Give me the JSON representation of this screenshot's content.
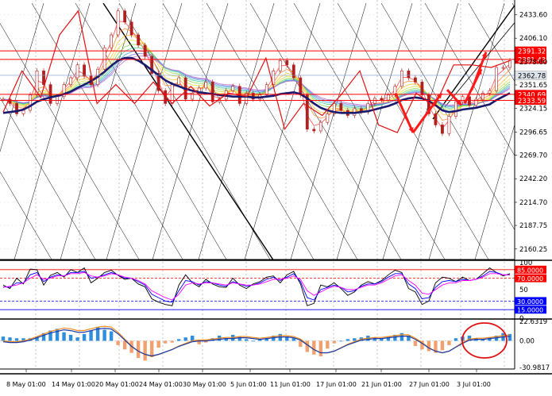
{
  "chart_data": {
    "type": "line",
    "instrument_note": "",
    "x_tick_labels": [
      "8 May 01:00",
      "14 May 01:00",
      "20 May 01:00",
      "24 May 01:00",
      "30 May 01:00",
      "5 Jun 01:00",
      "11 Jun 01:00",
      "17 Jun 01:00",
      "21 Jun 01:00",
      "27 Jun 01:00",
      "3 Jul 01:00"
    ],
    "main": {
      "ylim": [
        2148.0,
        2447.0
      ],
      "y_ticks": [
        "2433.60",
        "2406.10",
        "2378.60",
        "2351.65",
        "2324.15",
        "2296.65",
        "2269.70",
        "2242.20",
        "2214.70",
        "2187.75",
        "2160.25"
      ],
      "price_tag": {
        "text": "2362.78",
        "value": 2362.78
      },
      "levels": [
        {
          "label": "2391.32",
          "value": 2391.32,
          "color": "#ff0000"
        },
        {
          "label": "2381.43",
          "value": 2381.43,
          "color": "#ff0000"
        },
        {
          "label": "2340.69",
          "value": 2340.69,
          "color": "#ff0000"
        },
        {
          "label": "2333.59",
          "value": 2333.59,
          "color": "#ff0000"
        }
      ],
      "price": [
        2335,
        2330,
        2318,
        2322,
        2340,
        2368,
        2352,
        2330,
        2338,
        2352,
        2360,
        2375,
        2362,
        2352,
        2370,
        2395,
        2410,
        2438,
        2425,
        2410,
        2398,
        2385,
        2365,
        2345,
        2330,
        2352,
        2360,
        2335,
        2342,
        2348,
        2355,
        2332,
        2335,
        2345,
        2350,
        2330,
        2342,
        2335,
        2340,
        2352,
        2368,
        2380,
        2375,
        2360,
        2340,
        2300,
        2298,
        2308,
        2318,
        2330,
        2322,
        2316,
        2324,
        2320,
        2330,
        2336,
        2334,
        2340,
        2350,
        2368,
        2360,
        2355,
        2340,
        2318,
        2305,
        2295,
        2315,
        2332,
        2338,
        2328,
        2335,
        2342,
        2345,
        2372,
        2372,
        2380
      ],
      "ma_slow": [
        2319,
        2320,
        2321,
        2323,
        2327,
        2332,
        2335,
        2337,
        2339,
        2341,
        2344,
        2348,
        2352,
        2356,
        2361,
        2367,
        2374,
        2380,
        2383,
        2383,
        2380,
        2375,
        2369,
        2363,
        2357,
        2353,
        2350,
        2347,
        2345,
        2343,
        2342,
        2341,
        2340,
        2339,
        2338,
        2338,
        2338,
        2337,
        2337,
        2338,
        2339,
        2341,
        2342,
        2343,
        2341,
        2336,
        2330,
        2325,
        2322,
        2320,
        2319,
        2319,
        2319,
        2320,
        2321,
        2323,
        2325,
        2327,
        2330,
        2334,
        2336,
        2337,
        2336,
        2333,
        2328,
        2322,
        2320,
        2321,
        2323,
        2324,
        2325,
        2327,
        2329,
        2334,
        2338,
        2342
      ],
      "zigzag": [
        2320,
        2368,
        2337,
        2410,
        2438,
        2330,
        2352,
        2330,
        2355,
        2330,
        2350,
        2327,
        2342,
        2338,
        2383,
        2300,
        2330,
        2316,
        2340,
        2368,
        2305,
        2296,
        2342,
        2327,
        2375,
        2375,
        2372,
        2380
      ],
      "red_arrows": [
        {
          "from": [
            2340,
            2366
          ],
          "to": [
            2296,
            2296
          ]
        },
        {
          "from": [
            2300,
            2300
          ],
          "to": [
            2348,
            2342
          ]
        },
        {
          "from": [
            2338,
            2333
          ],
          "to": [
            2318,
            2336
          ]
        },
        {
          "from": [
            2360,
            2362
          ],
          "to": [
            2395,
            2388
          ]
        }
      ]
    },
    "oscillator": {
      "ylim": [
        0,
        100
      ],
      "y_ticks": [
        "100",
        "50",
        "0"
      ],
      "levels": [
        {
          "label": "85.0000",
          "value": 85,
          "color": "#ff0000"
        },
        {
          "label": "70.0000",
          "value": 70,
          "color": "#ff0000"
        },
        {
          "label": "30.0000",
          "value": 30,
          "color": "#0000ff"
        },
        {
          "label": "15.0000",
          "value": 15,
          "color": "#0000ff"
        }
      ],
      "series": [
        {
          "name": "",
          "color": "#000000",
          "values": [
            58,
            52,
            70,
            60,
            86,
            85,
            58,
            75,
            80,
            72,
            85,
            80,
            88,
            62,
            70,
            80,
            84,
            75,
            68,
            70,
            60,
            55,
            34,
            28,
            24,
            22,
            58,
            76,
            62,
            55,
            68,
            60,
            55,
            54,
            70,
            58,
            52,
            60,
            64,
            72,
            74,
            62,
            76,
            82,
            60,
            22,
            26,
            58,
            55,
            62,
            52,
            40,
            46,
            58,
            64,
            60,
            66,
            76,
            84,
            80,
            52,
            46,
            24,
            30,
            62,
            72,
            70,
            64,
            72,
            66,
            68,
            78,
            88,
            80,
            74,
            78
          ]
        },
        {
          "name": "",
          "color": "#0000ff",
          "values": [
            55,
            54,
            62,
            62,
            76,
            80,
            64,
            72,
            76,
            74,
            80,
            80,
            82,
            70,
            72,
            76,
            80,
            76,
            70,
            70,
            64,
            58,
            42,
            36,
            30,
            28,
            48,
            66,
            64,
            58,
            64,
            62,
            58,
            56,
            64,
            60,
            56,
            58,
            62,
            68,
            72,
            66,
            72,
            78,
            64,
            36,
            32,
            50,
            54,
            58,
            54,
            46,
            48,
            56,
            60,
            60,
            64,
            72,
            78,
            78,
            60,
            52,
            34,
            36,
            54,
            64,
            66,
            64,
            68,
            66,
            68,
            74,
            82,
            80,
            76,
            76
          ]
        },
        {
          "name": "",
          "color": "#ff00ff",
          "values": [
            54,
            56,
            58,
            62,
            70,
            76,
            68,
            70,
            74,
            74,
            78,
            78,
            80,
            74,
            72,
            74,
            78,
            76,
            72,
            70,
            66,
            60,
            48,
            42,
            36,
            32,
            42,
            58,
            62,
            60,
            62,
            62,
            60,
            58,
            62,
            60,
            58,
            58,
            60,
            64,
            68,
            68,
            70,
            74,
            68,
            48,
            40,
            46,
            52,
            56,
            54,
            50,
            50,
            54,
            58,
            58,
            62,
            68,
            74,
            76,
            66,
            58,
            44,
            42,
            50,
            58,
            62,
            62,
            66,
            66,
            68,
            72,
            78,
            78,
            76,
            76
          ]
        }
      ]
    },
    "macd": {
      "ylim": [
        -30.9817,
        22.6319
      ],
      "y_ticks": [
        "22.6319",
        "0.00",
        "-30.9817"
      ],
      "histogram": [
        5,
        4,
        3,
        3,
        3,
        5,
        9,
        12,
        14,
        10,
        7,
        4,
        8,
        12,
        16,
        13,
        11,
        -5,
        -10,
        -14,
        -20,
        -23,
        -19,
        -8,
        -3,
        -2,
        2,
        4,
        6,
        -4,
        -2,
        3,
        6,
        3,
        7,
        5,
        2,
        0,
        2,
        3,
        6,
        8,
        5,
        3,
        -7,
        -13,
        -16,
        -18,
        -9,
        -3,
        0,
        2,
        3,
        4,
        6,
        4,
        3,
        5,
        7,
        9,
        6,
        -6,
        -10,
        -12,
        -14,
        -11,
        -5,
        3,
        5,
        6,
        3,
        2,
        4,
        6,
        9,
        8
      ],
      "signal": [
        0,
        -1,
        -1,
        0,
        2,
        5,
        8,
        11,
        13,
        15,
        14,
        12,
        12,
        14,
        16,
        17,
        16,
        10,
        2,
        -6,
        -12,
        -16,
        -18,
        -16,
        -13,
        -10,
        -6,
        -3,
        0,
        1,
        1,
        2,
        3,
        4,
        4,
        5,
        5,
        4,
        3,
        4,
        5,
        6,
        6,
        5,
        2,
        -4,
        -10,
        -14,
        -14,
        -12,
        -8,
        -4,
        -1,
        2,
        3,
        4,
        4,
        5,
        6,
        7,
        7,
        3,
        -2,
        -8,
        -12,
        -14,
        -12,
        -7,
        -2,
        2,
        3,
        3,
        4,
        5,
        6,
        7
      ],
      "circle_note": ""
    }
  }
}
